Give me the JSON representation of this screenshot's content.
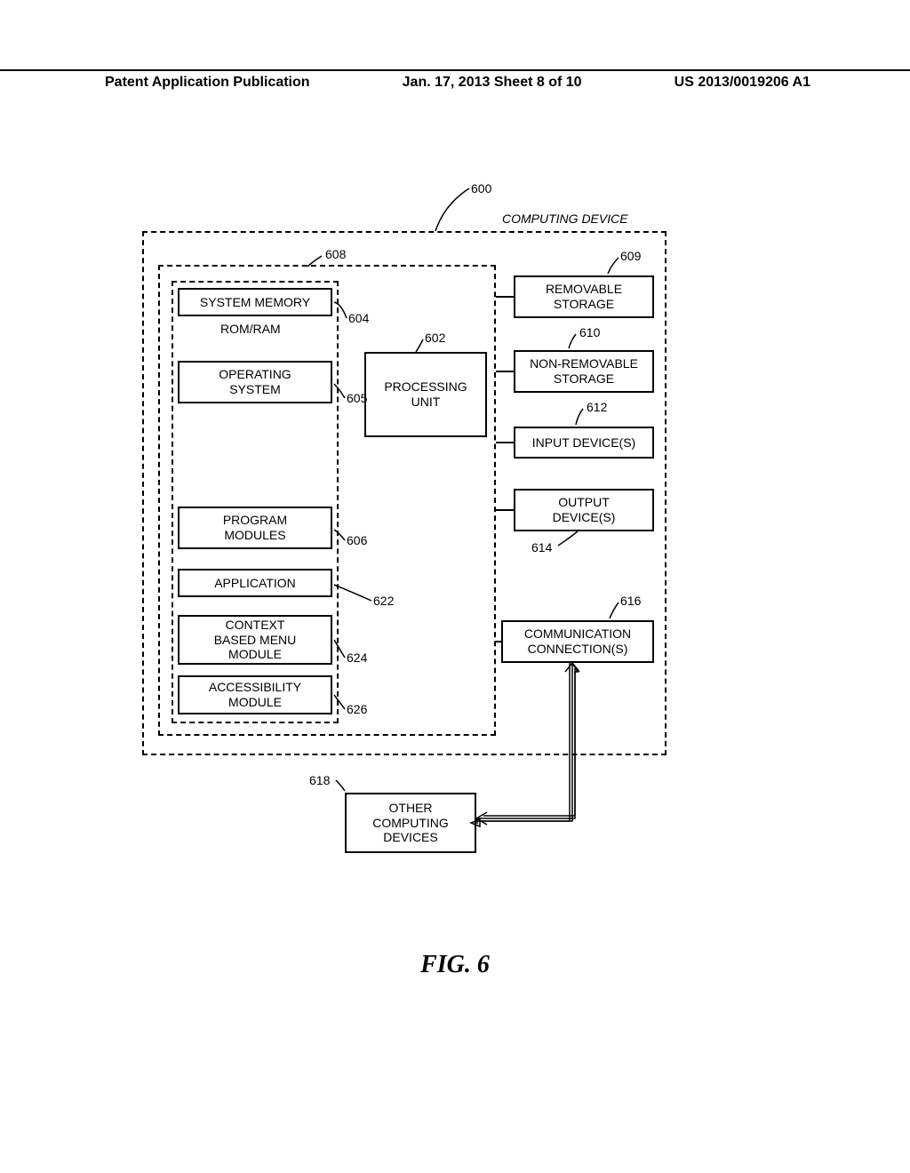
{
  "header": {
    "left": "Patent Application Publication",
    "mid": "Jan. 17, 2013  Sheet 8 of 10",
    "right": "US 2013/0019206 A1"
  },
  "refs": {
    "r600": "600",
    "r608": "608",
    "r609": "609",
    "r604": "604",
    "r602": "602",
    "r610": "610",
    "r605": "605",
    "r612": "612",
    "r614": "614",
    "r606": "606",
    "r616": "616",
    "r622": "622",
    "r624": "624",
    "r626": "626",
    "r618": "618"
  },
  "labels": {
    "computing_device": "COMPUTING DEVICE",
    "system_memory": "SYSTEM MEMORY",
    "rom_ram": "ROM/RAM",
    "operating_system_l1": "OPERATING",
    "operating_system_l2": "SYSTEM",
    "processing_l1": "PROCESSING",
    "processing_l2": "UNIT",
    "removable_l1": "REMOVABLE",
    "removable_l2": "STORAGE",
    "nonremovable_l1": "NON-REMOVABLE",
    "nonremovable_l2": "STORAGE",
    "input_devices": "INPUT DEVICE(S)",
    "output_l1": "OUTPUT",
    "output_l2": "DEVICE(S)",
    "program_l1": "PROGRAM",
    "program_l2": "MODULES",
    "application": "APPLICATION",
    "context_l1": "CONTEXT",
    "context_l2": "BASED MENU",
    "context_l3": "MODULE",
    "accessibility_l1": "ACCESSIBILITY",
    "accessibility_l2": "MODULE",
    "comm_l1": "COMMUNICATION",
    "comm_l2": "CONNECTION(S)",
    "other_l1": "OTHER",
    "other_l2": "COMPUTING",
    "other_l3": "DEVICES"
  },
  "figure": "FIG. 6"
}
